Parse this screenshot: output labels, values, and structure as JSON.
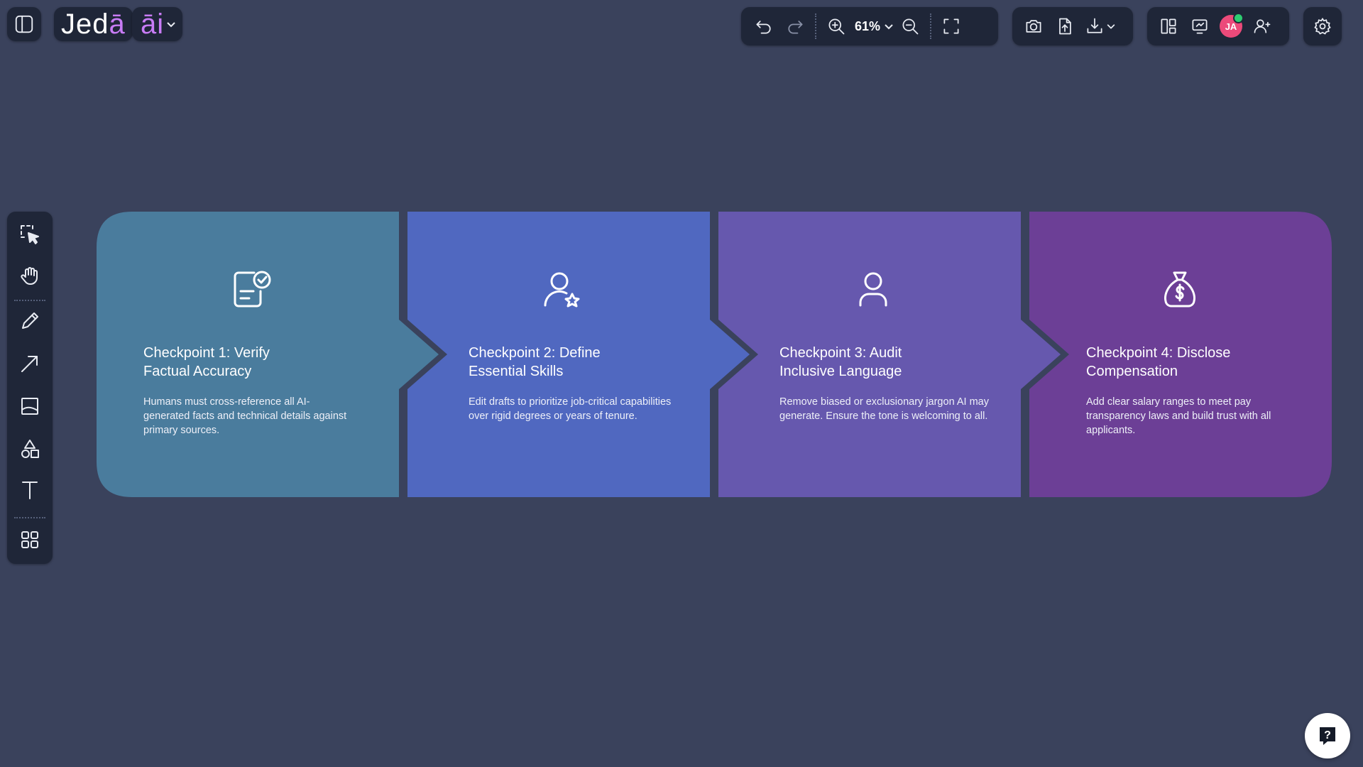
{
  "header": {
    "brand_main": "Jed",
    "brand_accent": "ā",
    "ai_label": "āi",
    "zoom_level": "61%",
    "avatar_initials": "JA"
  },
  "steps": [
    {
      "title": "Checkpoint 1: Verify Factual Accuracy",
      "description": "Humans must cross-reference all AI-generated facts and technical details against primary sources.",
      "icon": "document-check-icon",
      "color": "#4a7c9d"
    },
    {
      "title": "Checkpoint 2: Define Essential Skills",
      "description": "Edit drafts to prioritize job-critical capabilities over rigid degrees or years of tenure.",
      "icon": "user-star-icon",
      "color": "#5068c0"
    },
    {
      "title": "Checkpoint 3: Audit Inclusive Language",
      "description": "Remove biased or exclusionary jargon AI may generate. Ensure the tone is welcoming to all.",
      "icon": "user-icon",
      "color": "#6658ae"
    },
    {
      "title": "Checkpoint 4: Disclose Compensation",
      "description": "Add clear salary ranges to meet pay transparency laws and build trust with all applicants.",
      "icon": "money-bag-icon",
      "color": "#6c3f96"
    }
  ],
  "colors": {
    "background": "#3a425c",
    "panel": "#1f2638",
    "accent": "#c87cf6"
  }
}
